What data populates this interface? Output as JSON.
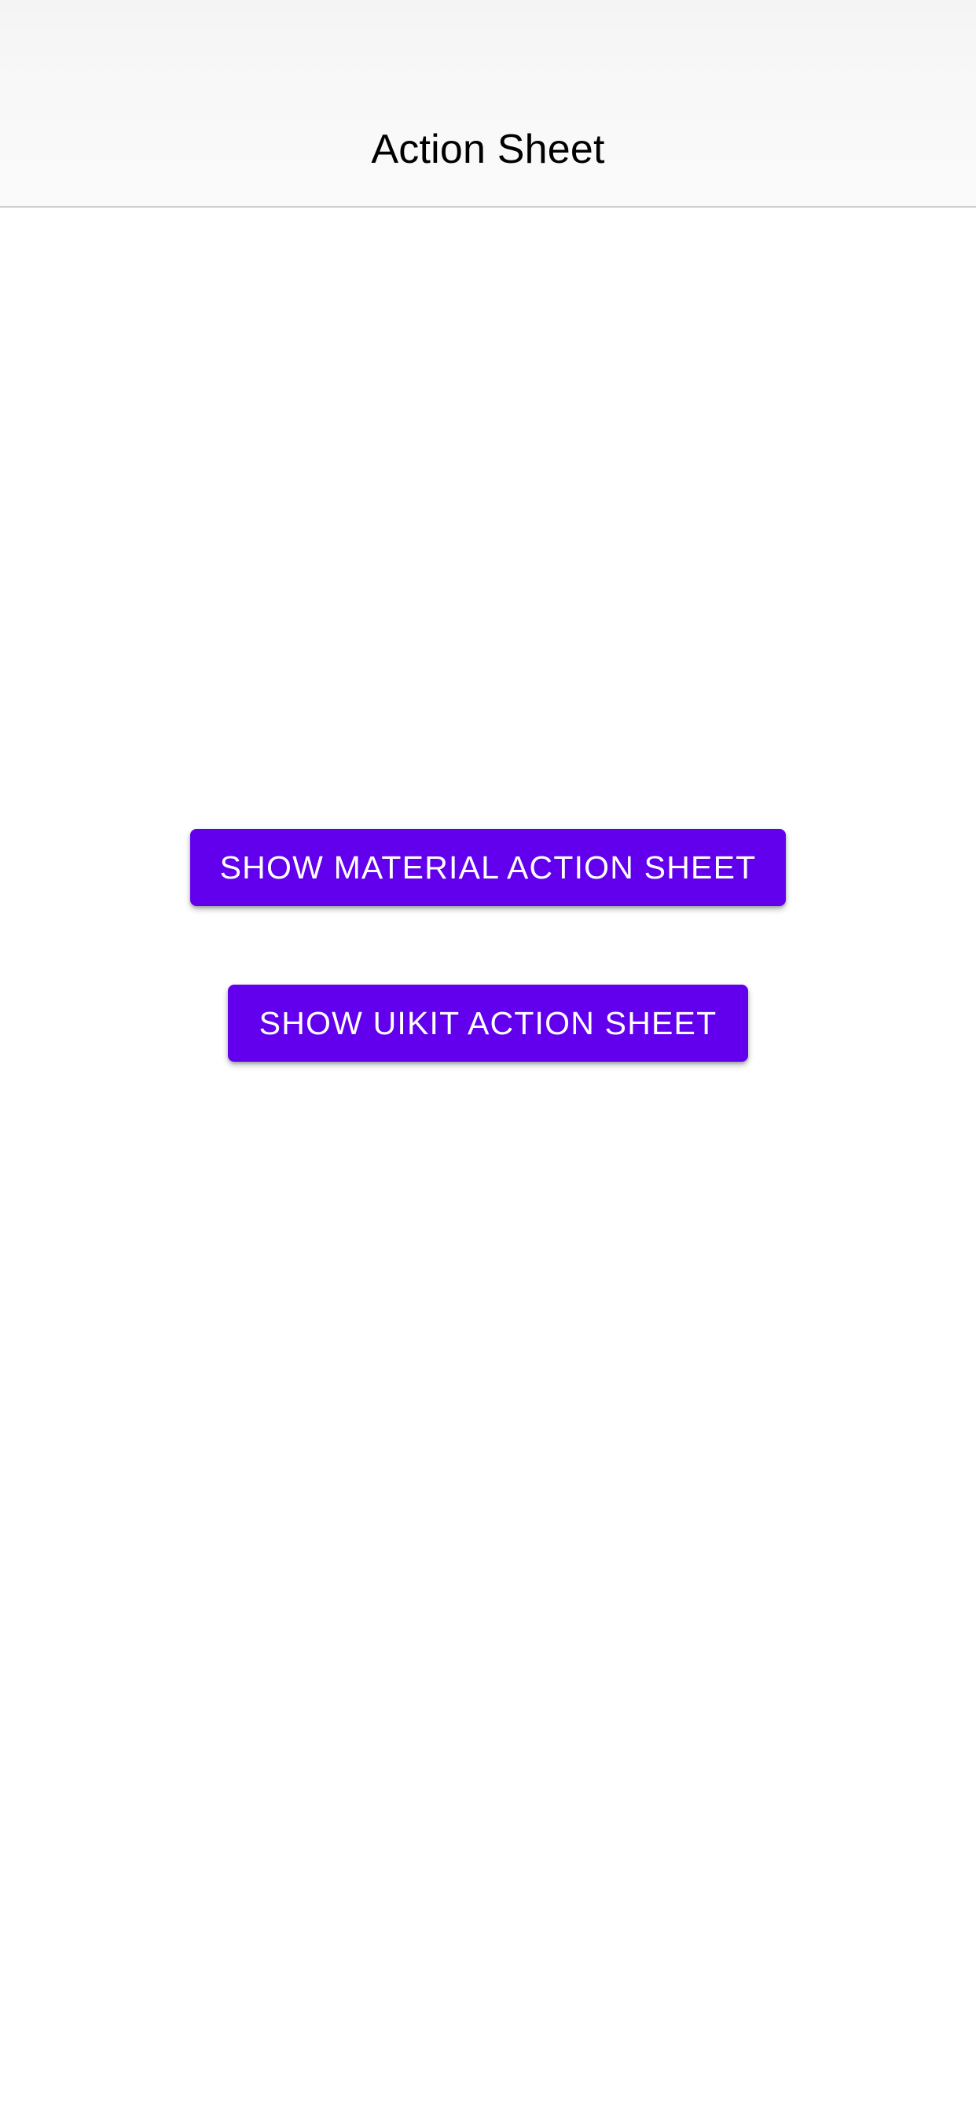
{
  "nav": {
    "title": "Action Sheet"
  },
  "buttons": {
    "material_label": "SHOW MATERIAL ACTION SHEET",
    "uikit_label": "SHOW UIKIT ACTION SHEET"
  },
  "colors": {
    "accent": "#6200ee",
    "button_text": "#ffffff",
    "background": "#ffffff",
    "nav_background": "#f7f7f7"
  }
}
